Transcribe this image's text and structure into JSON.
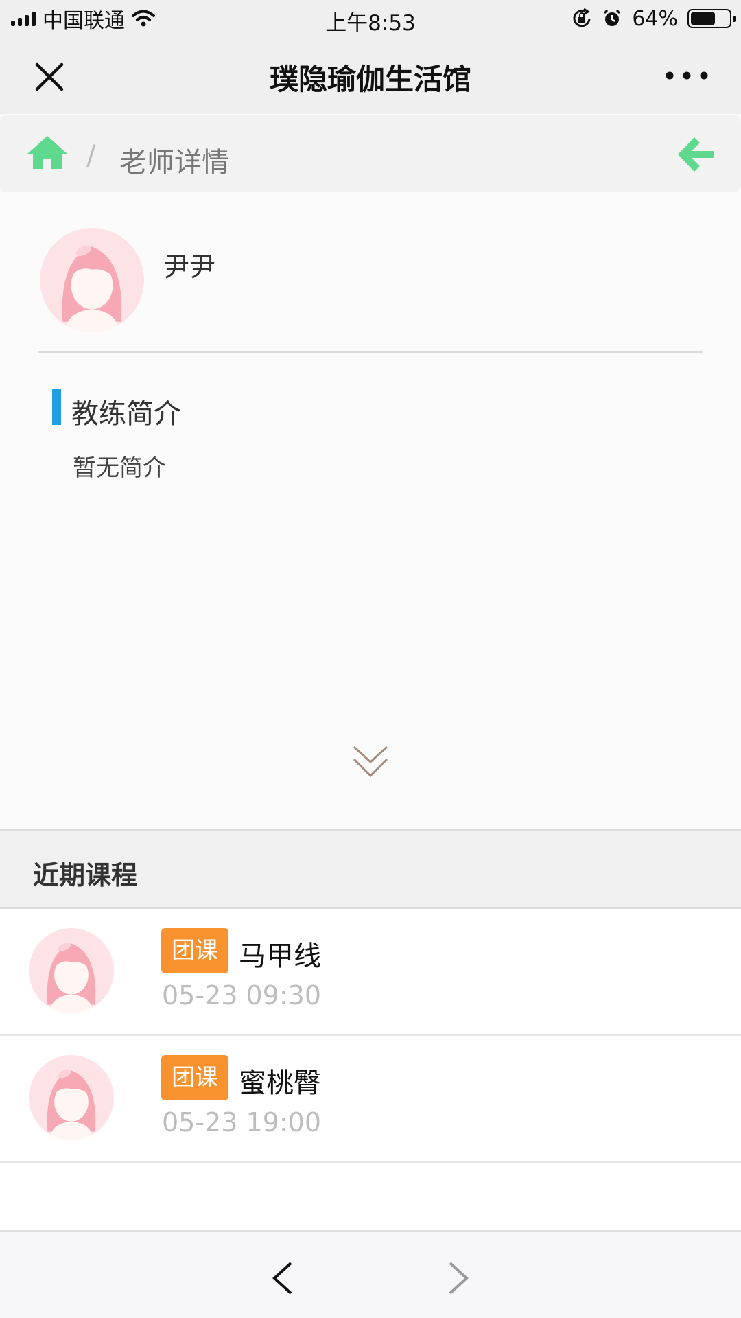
{
  "status_bar": {
    "carrier": "中国联通",
    "time": "上午8:53",
    "battery": "64%",
    "battery_level": 0.64,
    "icons": [
      "signal-icon",
      "wifi-icon",
      "orientation-lock-icon",
      "alarm-icon",
      "battery-icon"
    ]
  },
  "nav": {
    "title": "璞隐瑜伽生活馆",
    "close_icon": "close-icon",
    "more_icon": "more-icon"
  },
  "breadcrumb": {
    "separator": "/",
    "current": "老师详情",
    "home_icon": "home-icon",
    "back_icon": "back-arrow-icon"
  },
  "teacher": {
    "name": "尹尹",
    "intro_title": "教练简介",
    "intro_text": "暂无简介"
  },
  "courses": {
    "title": "近期课程",
    "items": [
      {
        "tag": "团课",
        "name": "马甲线",
        "time": "05-23 09:30"
      },
      {
        "tag": "团课",
        "name": "蜜桃臀",
        "time": "05-23 19:00"
      }
    ]
  },
  "colors": {
    "accent_green": "#5fd98e",
    "accent_blue": "#1e9fe0",
    "tag_orange": "#f7922e",
    "expand_brown": "#a58b7c"
  }
}
